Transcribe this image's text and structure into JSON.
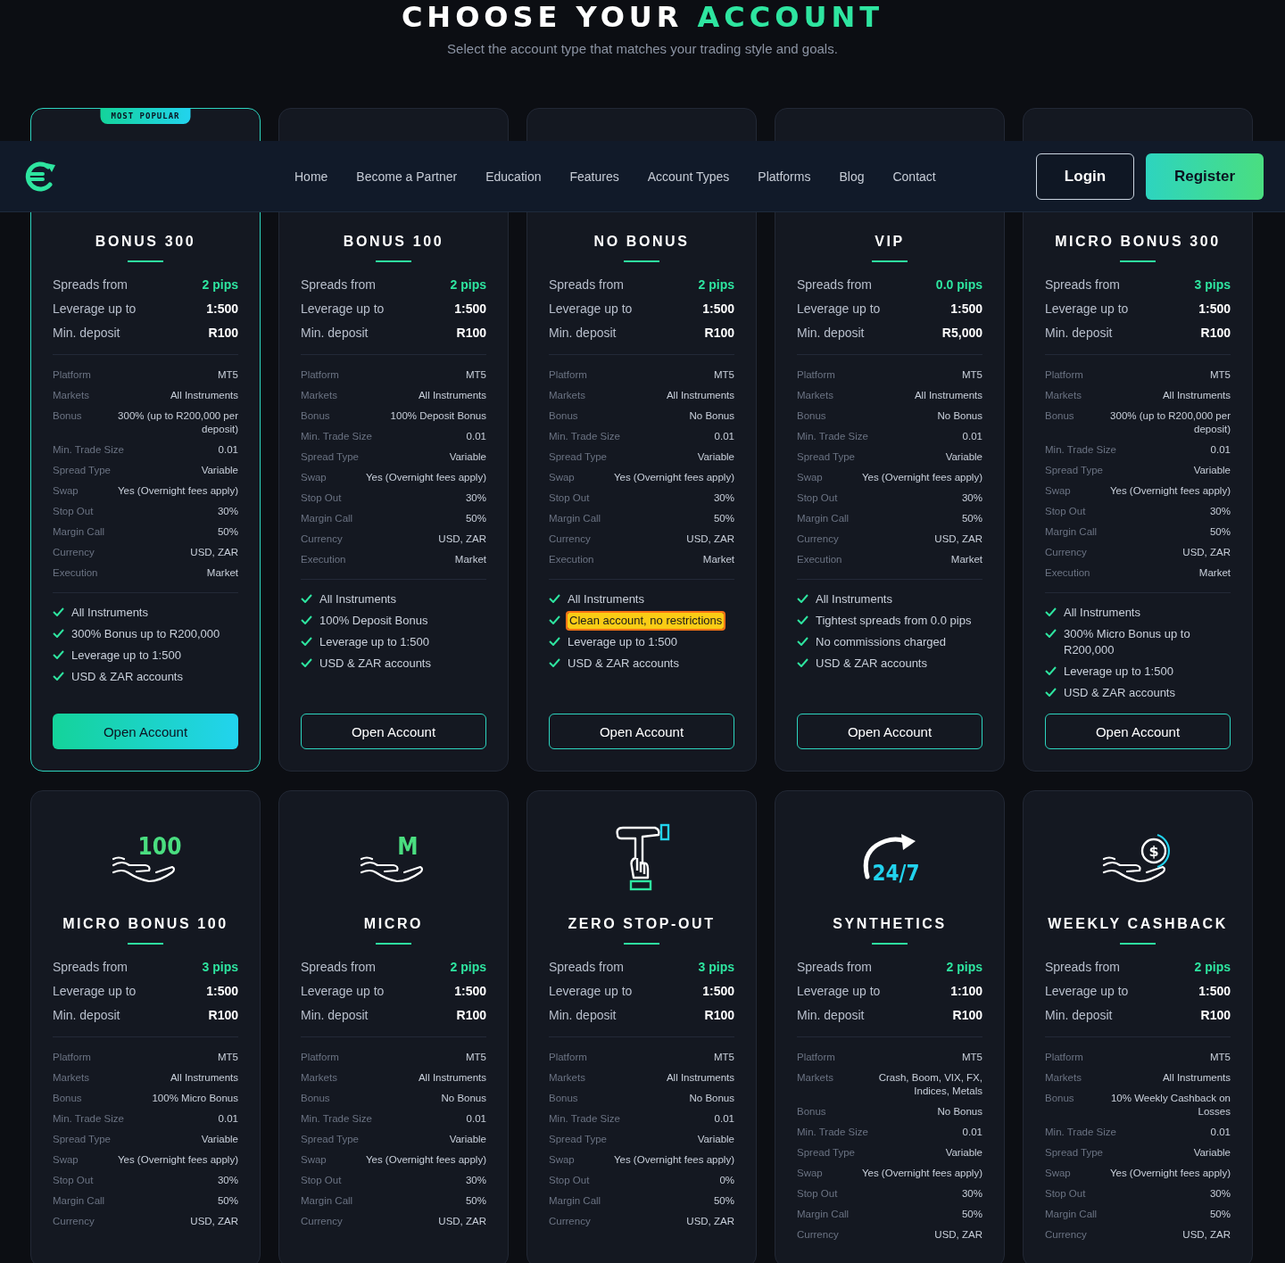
{
  "header": {
    "title": "CHOOSE YOUR",
    "title_accent": "ACCOUNT",
    "subtitle": "Select the account type that matches your trading style and goals."
  },
  "nav": {
    "links": [
      "Home",
      "Become a Partner",
      "Education",
      "Features",
      "Account Types",
      "Platforms",
      "Blog",
      "Contact"
    ],
    "login": "Login",
    "register": "Register"
  },
  "cards": [
    {
      "featured": true,
      "badge": "MOST POPULAR",
      "name": "BONUS 300",
      "stats": [
        {
          "label": "Spreads from",
          "value": "2 pips",
          "accent": true
        },
        {
          "label": "Leverage up to",
          "value": "1:500",
          "accent": false
        },
        {
          "label": "Min. deposit",
          "value": "R100",
          "accent": false
        }
      ],
      "details": [
        {
          "label": "Platform",
          "value": "MT5"
        },
        {
          "label": "Markets",
          "value": "All Instruments"
        },
        {
          "label": "Bonus",
          "value": "300% (up to R200,000 per deposit)"
        },
        {
          "label": "Min. Trade Size",
          "value": "0.01"
        },
        {
          "label": "Spread Type",
          "value": "Variable"
        },
        {
          "label": "Swap",
          "value": "Yes (Overnight fees apply)"
        },
        {
          "label": "Stop Out",
          "value": "30%"
        },
        {
          "label": "Margin Call",
          "value": "50%"
        },
        {
          "label": "Currency",
          "value": "USD, ZAR"
        },
        {
          "label": "Execution",
          "value": "Market"
        }
      ],
      "features": [
        {
          "text": "All Instruments",
          "highlighted": false
        },
        {
          "text": "300% Bonus up to R200,000",
          "highlighted": false
        },
        {
          "text": "Leverage up to 1:500",
          "highlighted": false
        },
        {
          "text": "USD & ZAR accounts",
          "highlighted": false
        }
      ],
      "button": "Open Account"
    },
    {
      "featured": false,
      "name": "BONUS 100",
      "stats": [
        {
          "label": "Spreads from",
          "value": "2 pips",
          "accent": true
        },
        {
          "label": "Leverage up to",
          "value": "1:500",
          "accent": false
        },
        {
          "label": "Min. deposit",
          "value": "R100",
          "accent": false
        }
      ],
      "details": [
        {
          "label": "Platform",
          "value": "MT5"
        },
        {
          "label": "Markets",
          "value": "All Instruments"
        },
        {
          "label": "Bonus",
          "value": "100% Deposit Bonus"
        },
        {
          "label": "Min. Trade Size",
          "value": "0.01"
        },
        {
          "label": "Spread Type",
          "value": "Variable"
        },
        {
          "label": "Swap",
          "value": "Yes (Overnight fees apply)"
        },
        {
          "label": "Stop Out",
          "value": "30%"
        },
        {
          "label": "Margin Call",
          "value": "50%"
        },
        {
          "label": "Currency",
          "value": "USD, ZAR"
        },
        {
          "label": "Execution",
          "value": "Market"
        }
      ],
      "features": [
        {
          "text": "All Instruments",
          "highlighted": false
        },
        {
          "text": "100% Deposit Bonus",
          "highlighted": false
        },
        {
          "text": "Leverage up to 1:500",
          "highlighted": false
        },
        {
          "text": "USD & ZAR accounts",
          "highlighted": false
        }
      ],
      "button": "Open Account"
    },
    {
      "featured": false,
      "name": "NO BONUS",
      "stats": [
        {
          "label": "Spreads from",
          "value": "2 pips",
          "accent": true
        },
        {
          "label": "Leverage up to",
          "value": "1:500",
          "accent": false
        },
        {
          "label": "Min. deposit",
          "value": "R100",
          "accent": false
        }
      ],
      "details": [
        {
          "label": "Platform",
          "value": "MT5"
        },
        {
          "label": "Markets",
          "value": "All Instruments"
        },
        {
          "label": "Bonus",
          "value": "No Bonus"
        },
        {
          "label": "Min. Trade Size",
          "value": "0.01"
        },
        {
          "label": "Spread Type",
          "value": "Variable"
        },
        {
          "label": "Swap",
          "value": "Yes (Overnight fees apply)"
        },
        {
          "label": "Stop Out",
          "value": "30%"
        },
        {
          "label": "Margin Call",
          "value": "50%"
        },
        {
          "label": "Currency",
          "value": "USD, ZAR"
        },
        {
          "label": "Execution",
          "value": "Market"
        }
      ],
      "features": [
        {
          "text": "All Instruments",
          "highlighted": false
        },
        {
          "text": "Clean account, no restrictions",
          "highlighted": true
        },
        {
          "text": "Leverage up to 1:500",
          "highlighted": false
        },
        {
          "text": "USD & ZAR accounts",
          "highlighted": false
        }
      ],
      "button": "Open Account"
    },
    {
      "featured": false,
      "name": "VIP",
      "stats": [
        {
          "label": "Spreads from",
          "value": "0.0 pips",
          "accent": true
        },
        {
          "label": "Leverage up to",
          "value": "1:500",
          "accent": false
        },
        {
          "label": "Min. deposit",
          "value": "R5,000",
          "accent": false
        }
      ],
      "details": [
        {
          "label": "Platform",
          "value": "MT5"
        },
        {
          "label": "Markets",
          "value": "All Instruments"
        },
        {
          "label": "Bonus",
          "value": "No Bonus"
        },
        {
          "label": "Min. Trade Size",
          "value": "0.01"
        },
        {
          "label": "Spread Type",
          "value": "Variable"
        },
        {
          "label": "Swap",
          "value": "Yes (Overnight fees apply)"
        },
        {
          "label": "Stop Out",
          "value": "30%"
        },
        {
          "label": "Margin Call",
          "value": "50%"
        },
        {
          "label": "Currency",
          "value": "USD, ZAR"
        },
        {
          "label": "Execution",
          "value": "Market"
        }
      ],
      "features": [
        {
          "text": "All Instruments",
          "highlighted": false
        },
        {
          "text": "Tightest spreads from 0.0 pips",
          "highlighted": false
        },
        {
          "text": "No commissions charged",
          "highlighted": false
        },
        {
          "text": "USD & ZAR accounts",
          "highlighted": false
        }
      ],
      "button": "Open Account"
    },
    {
      "featured": false,
      "name": "MICRO BONUS 300",
      "stats": [
        {
          "label": "Spreads from",
          "value": "3 pips",
          "accent": true
        },
        {
          "label": "Leverage up to",
          "value": "1:500",
          "accent": false
        },
        {
          "label": "Min. deposit",
          "value": "R100",
          "accent": false
        }
      ],
      "details": [
        {
          "label": "Platform",
          "value": "MT5"
        },
        {
          "label": "Markets",
          "value": "All Instruments"
        },
        {
          "label": "Bonus",
          "value": "300% (up to R200,000 per deposit)"
        },
        {
          "label": "Min. Trade Size",
          "value": "0.01"
        },
        {
          "label": "Spread Type",
          "value": "Variable"
        },
        {
          "label": "Swap",
          "value": "Yes (Overnight fees apply)"
        },
        {
          "label": "Stop Out",
          "value": "30%"
        },
        {
          "label": "Margin Call",
          "value": "50%"
        },
        {
          "label": "Currency",
          "value": "USD, ZAR"
        },
        {
          "label": "Execution",
          "value": "Market"
        }
      ],
      "features": [
        {
          "text": "All Instruments",
          "highlighted": false
        },
        {
          "text": "300% Micro Bonus up to R200,000",
          "highlighted": false
        },
        {
          "text": "Leverage up to 1:500",
          "highlighted": false
        },
        {
          "text": "USD & ZAR accounts",
          "highlighted": false
        }
      ],
      "button": "Open Account"
    },
    {
      "featured": false,
      "icon": {
        "kind": "hand",
        "text": "100"
      },
      "name": "MICRO BONUS 100",
      "stats": [
        {
          "label": "Spreads from",
          "value": "3 pips",
          "accent": true
        },
        {
          "label": "Leverage up to",
          "value": "1:500",
          "accent": false
        },
        {
          "label": "Min. deposit",
          "value": "R100",
          "accent": false
        }
      ],
      "details": [
        {
          "label": "Platform",
          "value": "MT5"
        },
        {
          "label": "Markets",
          "value": "All Instruments"
        },
        {
          "label": "Bonus",
          "value": "100% Micro Bonus"
        },
        {
          "label": "Min. Trade Size",
          "value": "0.01"
        },
        {
          "label": "Spread Type",
          "value": "Variable"
        },
        {
          "label": "Swap",
          "value": "Yes (Overnight fees apply)"
        },
        {
          "label": "Stop Out",
          "value": "30%"
        },
        {
          "label": "Margin Call",
          "value": "50%"
        },
        {
          "label": "Currency",
          "value": "USD, ZAR"
        }
      ]
    },
    {
      "featured": false,
      "icon": {
        "kind": "hand",
        "text": "M"
      },
      "name": "MICRO",
      "stats": [
        {
          "label": "Spreads from",
          "value": "2 pips",
          "accent": true
        },
        {
          "label": "Leverage up to",
          "value": "1:500",
          "accent": false
        },
        {
          "label": "Min. deposit",
          "value": "R100",
          "accent": false
        }
      ],
      "details": [
        {
          "label": "Platform",
          "value": "MT5"
        },
        {
          "label": "Markets",
          "value": "All Instruments"
        },
        {
          "label": "Bonus",
          "value": "No Bonus"
        },
        {
          "label": "Min. Trade Size",
          "value": "0.01"
        },
        {
          "label": "Spread Type",
          "value": "Variable"
        },
        {
          "label": "Swap",
          "value": "Yes (Overnight fees apply)"
        },
        {
          "label": "Stop Out",
          "value": "30%"
        },
        {
          "label": "Margin Call",
          "value": "50%"
        },
        {
          "label": "Currency",
          "value": "USD, ZAR"
        }
      ]
    },
    {
      "featured": false,
      "icon": {
        "kind": "stop-hand"
      },
      "name": "ZERO STOP-OUT",
      "stats": [
        {
          "label": "Spreads from",
          "value": "3 pips",
          "accent": true
        },
        {
          "label": "Leverage up to",
          "value": "1:500",
          "accent": false
        },
        {
          "label": "Min. deposit",
          "value": "R100",
          "accent": false
        }
      ],
      "details": [
        {
          "label": "Platform",
          "value": "MT5"
        },
        {
          "label": "Markets",
          "value": "All Instruments"
        },
        {
          "label": "Bonus",
          "value": "No Bonus"
        },
        {
          "label": "Min. Trade Size",
          "value": "0.01"
        },
        {
          "label": "Spread Type",
          "value": "Variable"
        },
        {
          "label": "Swap",
          "value": "Yes (Overnight fees apply)"
        },
        {
          "label": "Stop Out",
          "value": "0%"
        },
        {
          "label": "Margin Call",
          "value": "50%"
        },
        {
          "label": "Currency",
          "value": "USD, ZAR"
        }
      ]
    },
    {
      "featured": false,
      "icon": {
        "kind": "clock-arrow",
        "text": "24/7"
      },
      "name": "SYNTHETICS",
      "stats": [
        {
          "label": "Spreads from",
          "value": "2 pips",
          "accent": true
        },
        {
          "label": "Leverage up to",
          "value": "1:100",
          "accent": false
        },
        {
          "label": "Min. deposit",
          "value": "R100",
          "accent": false
        }
      ],
      "details": [
        {
          "label": "Platform",
          "value": "MT5"
        },
        {
          "label": "Markets",
          "value": "Crash, Boom, VIX, FX, Indices, Metals"
        },
        {
          "label": "Bonus",
          "value": "No Bonus"
        },
        {
          "label": "Min. Trade Size",
          "value": "0.01"
        },
        {
          "label": "Spread Type",
          "value": "Variable"
        },
        {
          "label": "Swap",
          "value": "Yes (Overnight fees apply)"
        },
        {
          "label": "Stop Out",
          "value": "30%"
        },
        {
          "label": "Margin Call",
          "value": "50%"
        },
        {
          "label": "Currency",
          "value": "USD, ZAR"
        }
      ]
    },
    {
      "featured": false,
      "icon": {
        "kind": "cashback",
        "text": "$"
      },
      "name": "WEEKLY CASHBACK",
      "stats": [
        {
          "label": "Spreads from",
          "value": "2 pips",
          "accent": true
        },
        {
          "label": "Leverage up to",
          "value": "1:500",
          "accent": false
        },
        {
          "label": "Min. deposit",
          "value": "R100",
          "accent": false
        }
      ],
      "details": [
        {
          "label": "Platform",
          "value": "MT5"
        },
        {
          "label": "Markets",
          "value": "All Instruments"
        },
        {
          "label": "Bonus",
          "value": "10% Weekly Cashback on Losses"
        },
        {
          "label": "Min. Trade Size",
          "value": "0.01"
        },
        {
          "label": "Spread Type",
          "value": "Variable"
        },
        {
          "label": "Swap",
          "value": "Yes (Overnight fees apply)"
        },
        {
          "label": "Stop Out",
          "value": "30%"
        },
        {
          "label": "Margin Call",
          "value": "50%"
        },
        {
          "label": "Currency",
          "value": "USD, ZAR"
        }
      ]
    }
  ]
}
